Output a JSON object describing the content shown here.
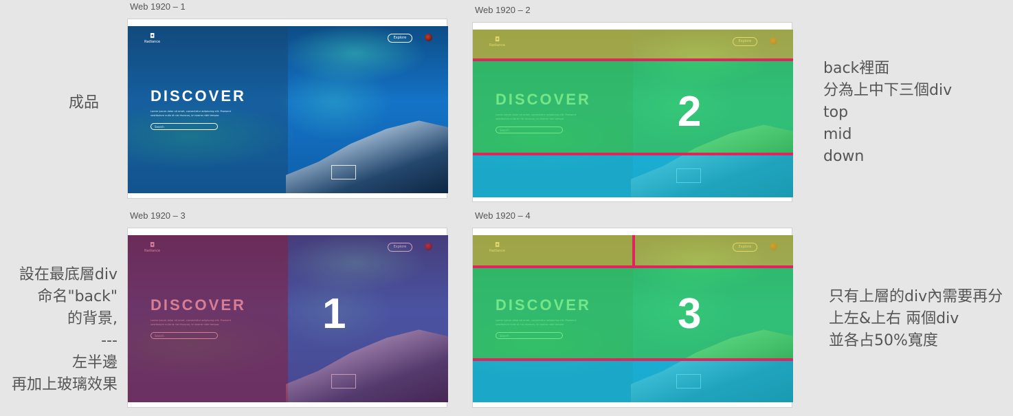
{
  "artboards": [
    {
      "label": "Web 1920 – 1"
    },
    {
      "label": "Web 1920 – 2"
    },
    {
      "label": "Web 1920 – 3"
    },
    {
      "label": "Web 1920 – 4"
    }
  ],
  "mock": {
    "brand": "Radiance",
    "explore_label": "Explore",
    "heading": "DISCOVER",
    "body_text": "Lorem ipsum dolor sit amet, consectetur adipiscing elit. Praesent vestibulum nulla id nisi rhoncus, id viverra nibh tempor.",
    "search_placeholder": "Search"
  },
  "overlay_numbers": {
    "second": "2",
    "third": "1",
    "fourth": "3"
  },
  "notes": {
    "finished": "成品",
    "right_top": [
      "back裡面",
      "分為上中下三個div",
      "top",
      "mid",
      "down"
    ],
    "left_bottom": [
      "設在最底層div",
      "命名\"back\"",
      "的背景,",
      "---",
      "左半邊",
      "再加上玻璃效果"
    ],
    "right_bottom": [
      "只有上層的div內需要再分",
      "上左&上右 兩個div",
      "並各占50%寬度"
    ]
  },
  "colors": {
    "highlight_line": "#e0245e",
    "overlay_green": "#3ddc5a",
    "overlay_yellow": "#d6c832",
    "overlay_cyan": "#1ec8dc",
    "overlay_red": "#b4143c"
  }
}
